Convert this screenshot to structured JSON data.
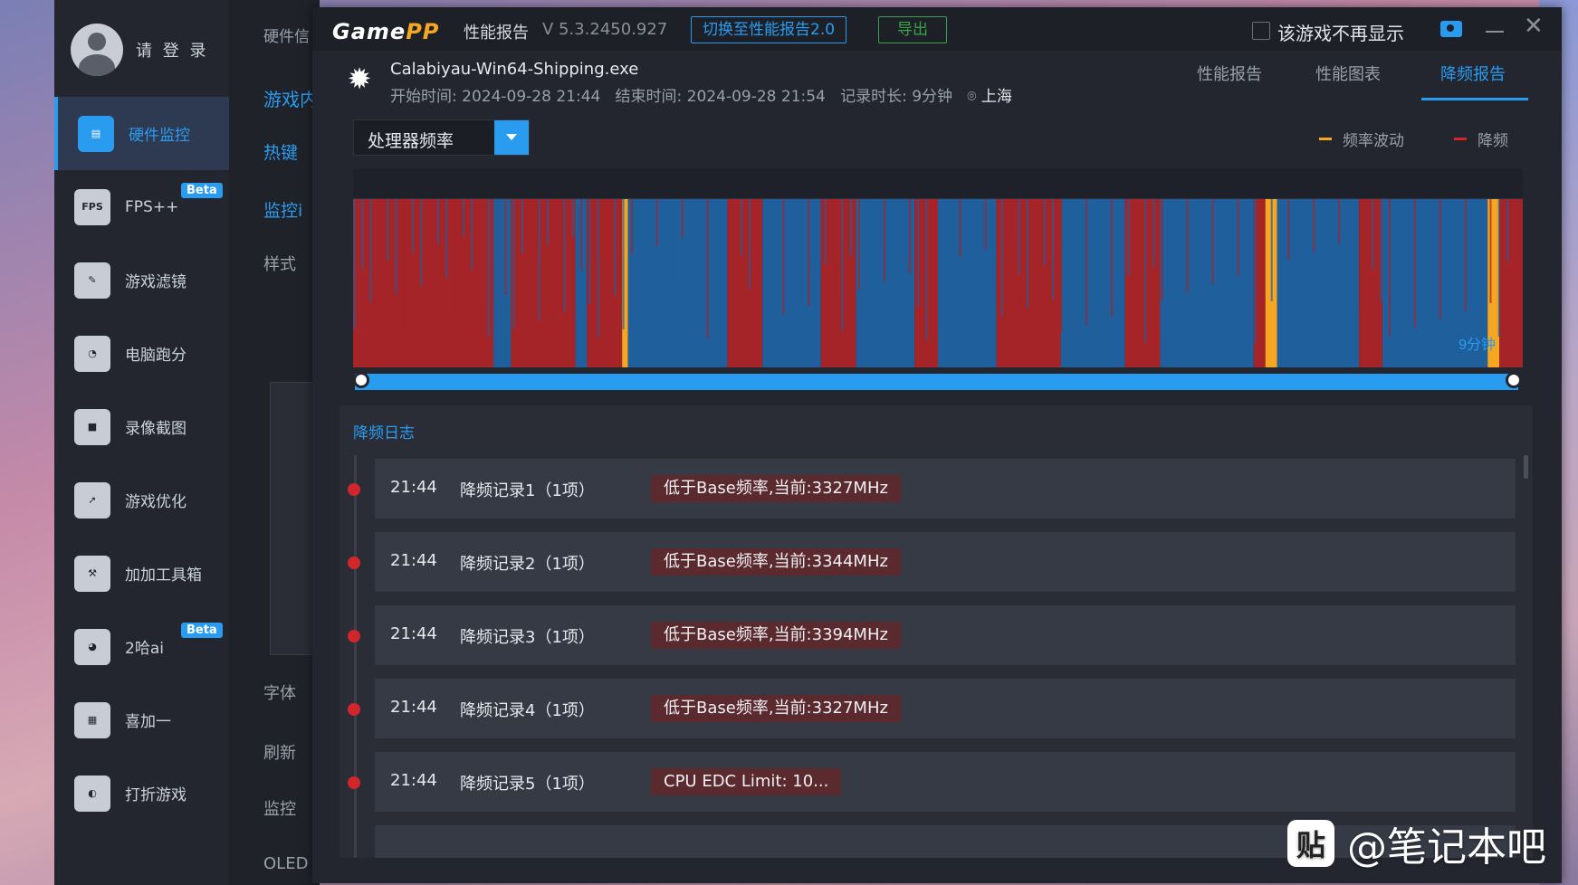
{
  "sidebar": {
    "login": "请 登 录",
    "items": [
      {
        "label": "硬件监控",
        "icon": "hardware-monitor-icon",
        "badge": ""
      },
      {
        "label": "FPS++",
        "icon": "fps-icon",
        "badge": "Beta"
      },
      {
        "label": "游戏滤镜",
        "icon": "filter-icon",
        "badge": ""
      },
      {
        "label": "电脑跑分",
        "icon": "speedometer-icon",
        "badge": ""
      },
      {
        "label": "录像截图",
        "icon": "camera-icon",
        "badge": ""
      },
      {
        "label": "游戏优化",
        "icon": "rocket-icon",
        "badge": ""
      },
      {
        "label": "加加工具箱",
        "icon": "toolbox-icon",
        "badge": ""
      },
      {
        "label": "2哈ai",
        "icon": "husky-icon",
        "badge": "Beta"
      },
      {
        "label": "喜加一",
        "icon": "gift-icon",
        "badge": ""
      },
      {
        "label": "打折游戏",
        "icon": "discount-icon",
        "badge": ""
      }
    ]
  },
  "midpanel": {
    "top": "硬件信",
    "section": "游戏内",
    "items": [
      "热键",
      "监控i",
      "样式",
      "字体",
      "刷新",
      "监控",
      "OLED"
    ]
  },
  "window": {
    "logo_a": "Game",
    "logo_b": "PP",
    "title": "性能报告",
    "version": "V 5.3.2450.927",
    "switch_button": "切换至性能报告2.0",
    "export_button": "导出",
    "hide_checkbox": "该游戏不再显示"
  },
  "game": {
    "exe": "Calabiyau-Win64-Shipping.exe",
    "start": "开始时间: 2024-09-28 21:44",
    "end": "结束时间: 2024-09-28 21:54",
    "duration": "记录时长: 9分钟",
    "city": "上海"
  },
  "tabs": [
    "性能报告",
    "性能图表",
    "降频报告"
  ],
  "active_tab": 2,
  "metric_select": "处理器频率",
  "legend": [
    {
      "label": "频率波动",
      "color": "#f5a623"
    },
    {
      "label": "降频",
      "color": "#d0262c"
    }
  ],
  "chart_data": {
    "type": "area",
    "x_label_end": "9分钟",
    "series": [
      {
        "name": "频率波动",
        "color": "#f5a623"
      },
      {
        "name": "降频",
        "color": "#d0262c"
      }
    ],
    "band_colors": {
      "normal": "#1f5f9c",
      "throttle": "#a52428"
    }
  },
  "log": {
    "title": "降频日志",
    "rows": [
      {
        "time": "21:44",
        "name": "降频记录1（1项）",
        "reason": "低于Base频率,当前:3327MHz"
      },
      {
        "time": "21:44",
        "name": "降频记录2（1项）",
        "reason": "低于Base频率,当前:3344MHz"
      },
      {
        "time": "21:44",
        "name": "降频记录3（1项）",
        "reason": "低于Base频率,当前:3394MHz"
      },
      {
        "time": "21:44",
        "name": "降频记录4（1项）",
        "reason": "低于Base频率,当前:3327MHz"
      },
      {
        "time": "21:44",
        "name": "降频记录5（1项）",
        "reason": "CPU EDC Limit: 10..."
      }
    ]
  },
  "watermark": "@笔记本吧",
  "watermark_icon": "贴"
}
